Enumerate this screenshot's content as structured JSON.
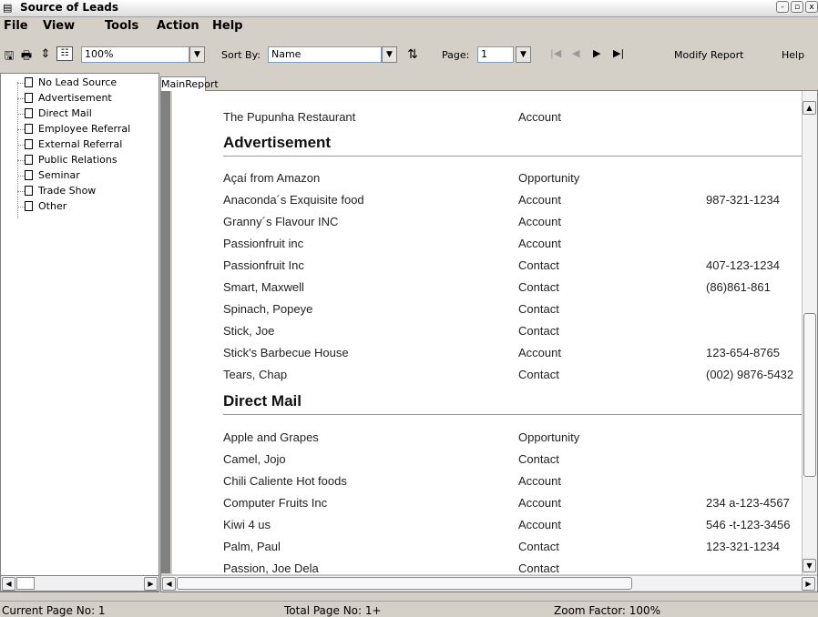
{
  "window": {
    "title": "Source of Leads",
    "buttons": [
      "-",
      "▫",
      "x"
    ]
  },
  "menubar": {
    "items": [
      "File",
      "View",
      "Tools",
      "Action",
      "Help"
    ]
  },
  "toolbar": {
    "zoom": "100%",
    "sort_label": "Sort By:",
    "sort_value": "Name",
    "page_label": "Page:",
    "page_value": "1",
    "modify_report": "Modify Report",
    "help": "Help"
  },
  "tree": {
    "items": [
      "No Lead Source",
      "Advertisement",
      "Direct Mail",
      "Employee Referral",
      "External Referral",
      "Public Relations",
      "Seminar",
      "Trade Show",
      "Other"
    ]
  },
  "report_tab": "MainReport",
  "report": {
    "top_row": {
      "name": "The Pupunha Restaurant",
      "type": "Account",
      "phone": ""
    },
    "groups": [
      {
        "title": "Advertisement",
        "rows": [
          {
            "name": "Açaí from Amazon",
            "type": "Opportunity",
            "phone": ""
          },
          {
            "name": "Anaconda´s Exquisite food",
            "type": "Account",
            "phone": "987-321-1234"
          },
          {
            "name": "Granny´s  Flavour INC",
            "type": "Account",
            "phone": ""
          },
          {
            "name": "Passionfruit inc",
            "type": "Account",
            "phone": ""
          },
          {
            "name": "Passionfruit Inc",
            "type": "Contact",
            "phone": "407-123-1234"
          },
          {
            "name": "Smart, Maxwell",
            "type": "Contact",
            "phone": "(86)861-861"
          },
          {
            "name": "Spinach, Popeye",
            "type": "Contact",
            "phone": ""
          },
          {
            "name": "Stick, Joe",
            "type": "Contact",
            "phone": ""
          },
          {
            "name": "Stick's Barbecue House",
            "type": "Account",
            "phone": "123-654-8765"
          },
          {
            "name": "Tears, Chap",
            "type": "Contact",
            "phone": "(002) 9876-5432"
          }
        ]
      },
      {
        "title": "Direct Mail",
        "rows": [
          {
            "name": "Apple and Grapes",
            "type": "Opportunity",
            "phone": ""
          },
          {
            "name": "Camel, Jojo",
            "type": "Contact",
            "phone": ""
          },
          {
            "name": "Chili Caliente Hot foods",
            "type": "Account",
            "phone": ""
          },
          {
            "name": "Computer Fruits Inc",
            "type": "Account",
            "phone": "234 a-123-4567"
          },
          {
            "name": "Kiwi 4 us",
            "type": "Account",
            "phone": "546 -t-123-3456"
          },
          {
            "name": "Palm, Paul",
            "type": "Contact",
            "phone": "123-321-1234"
          },
          {
            "name": "Passion, Joe Dela",
            "type": "Contact",
            "phone": ""
          }
        ]
      }
    ]
  },
  "statusbar": {
    "current_page": "Current Page No: 1",
    "total_page": "Total Page No: 1+",
    "zoom_factor": "Zoom Factor: 100%"
  }
}
